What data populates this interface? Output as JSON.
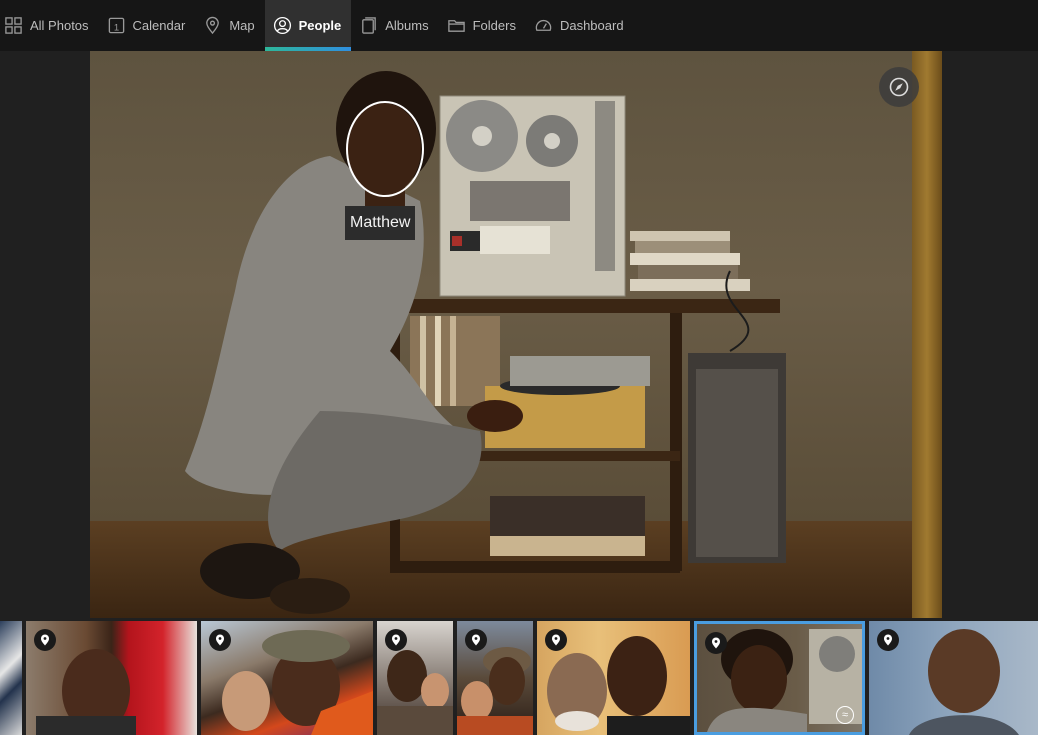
{
  "nav": {
    "tabs": [
      {
        "label": "All Photos",
        "icon": "grid-icon",
        "active": false
      },
      {
        "label": "Calendar",
        "icon": "calendar-icon",
        "active": false
      },
      {
        "label": "Map",
        "icon": "map-pin-icon",
        "active": false
      },
      {
        "label": "People",
        "icon": "person-icon",
        "active": true
      },
      {
        "label": "Albums",
        "icon": "album-icon",
        "active": false
      },
      {
        "label": "Folders",
        "icon": "folder-icon",
        "active": false
      },
      {
        "label": "Dashboard",
        "icon": "gauge-icon",
        "active": false
      }
    ],
    "calendar_day": "1",
    "accent_colors": [
      "#2eb79a",
      "#2f8fe0"
    ]
  },
  "viewer": {
    "face_tag": {
      "name": "Matthew"
    },
    "compass_icon": "compass-icon"
  },
  "filmstrip": {
    "selected_color": "#4a9de0",
    "thumbnails": [
      {
        "has_location": false,
        "selected": false,
        "live": false
      },
      {
        "has_location": true,
        "selected": false,
        "live": false
      },
      {
        "has_location": true,
        "selected": false,
        "live": false
      },
      {
        "has_location": true,
        "selected": false,
        "live": false
      },
      {
        "has_location": true,
        "selected": false,
        "live": false
      },
      {
        "has_location": true,
        "selected": false,
        "live": false
      },
      {
        "has_location": true,
        "selected": true,
        "live": true
      },
      {
        "has_location": true,
        "selected": false,
        "live": false
      }
    ]
  }
}
